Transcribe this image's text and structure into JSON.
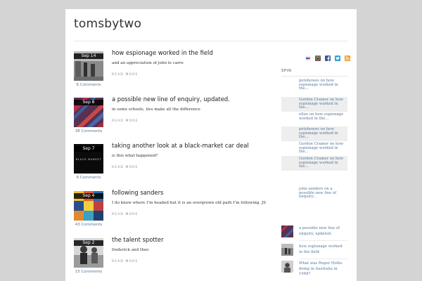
{
  "site": {
    "title": "tomsbytwo"
  },
  "posts": [
    {
      "date": "Sep 14",
      "title": "how espionage worked in the field",
      "excerpt": "and an appreciation of john le carre",
      "read_more": "READ MORE",
      "comments": "6 Comments"
    },
    {
      "date": "Sep 8",
      "title": "a possible new line of enquiry, updated.",
      "excerpt": "in some schools, ties make all the difference",
      "read_more": "READ MORE",
      "comments": "38 Comments"
    },
    {
      "date": "Sep 7",
      "title": "taking another look at a black-market car deal",
      "excerpt": "is this what happened?",
      "read_more": "READ MORE",
      "comments": "6 Comments",
      "thumb_text": "BLACK MARKET"
    },
    {
      "date": "Sep 4",
      "title": "following sanders",
      "excerpt": "I do know where I’m headed but it is an overgrown old path I’m following. JS",
      "read_more": "READ MORE",
      "comments": "43 Comments"
    },
    {
      "date": "Sep 2",
      "title": "the talent spotter",
      "excerpt": "frederick and theo",
      "read_more": "READ MORE",
      "comments": "15 Comments"
    }
  ],
  "sidebar": {
    "social_icons": [
      "flickr-icon",
      "instagram-icon",
      "facebook-icon",
      "twitter-icon",
      "rss-icon"
    ],
    "colors": {
      "flickr": "#e0387a",
      "instagram": "#6b5344",
      "facebook": "#3b5998",
      "twitter": "#33a2d9",
      "rss": "#f39c30"
    },
    "section_label": "SPIN",
    "recent_comments": [
      "petebowes on how espionage worked in the...",
      "Gordon Cramer on how espionage worked in the...",
      "ellen on how espionage worked in the...",
      "petebowes on how espionage worked in the...",
      "Gordon Cramer on how espionage worked in the...",
      "Gordon Cramer on how espionage worked in the...",
      "john sanders on a possible new line of enquiry..."
    ],
    "recent_posts": [
      "a possible new line of enquiry, updated.",
      "how espionage worked in the field",
      "What was Roger Hollis doing in Australia in 1948?"
    ]
  }
}
